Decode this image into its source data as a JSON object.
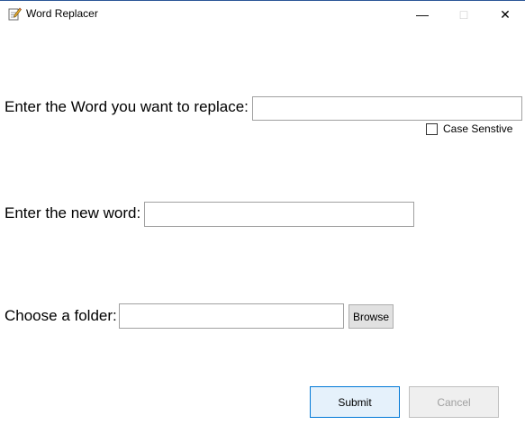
{
  "window": {
    "title": "Word Replacer",
    "app_icon": "notepad-pencil-icon",
    "controls": {
      "minimize": "—",
      "maximize": "□",
      "close": "✕"
    }
  },
  "form": {
    "replace_label": "Enter the Word you want to replace:",
    "replace_value": "",
    "case_sensitive_label": "Case Senstive",
    "case_sensitive_checked": false,
    "new_word_label": "Enter the new word:",
    "new_word_value": "",
    "folder_label": "Choose a folder:",
    "folder_value": "",
    "browse_label": "Browse"
  },
  "actions": {
    "submit_label": "Submit",
    "cancel_label": "Cancel",
    "cancel_enabled": false
  },
  "colors": {
    "title_border": "#2b5797",
    "submit_border": "#0078d7",
    "submit_bg": "#e5f1fb"
  }
}
